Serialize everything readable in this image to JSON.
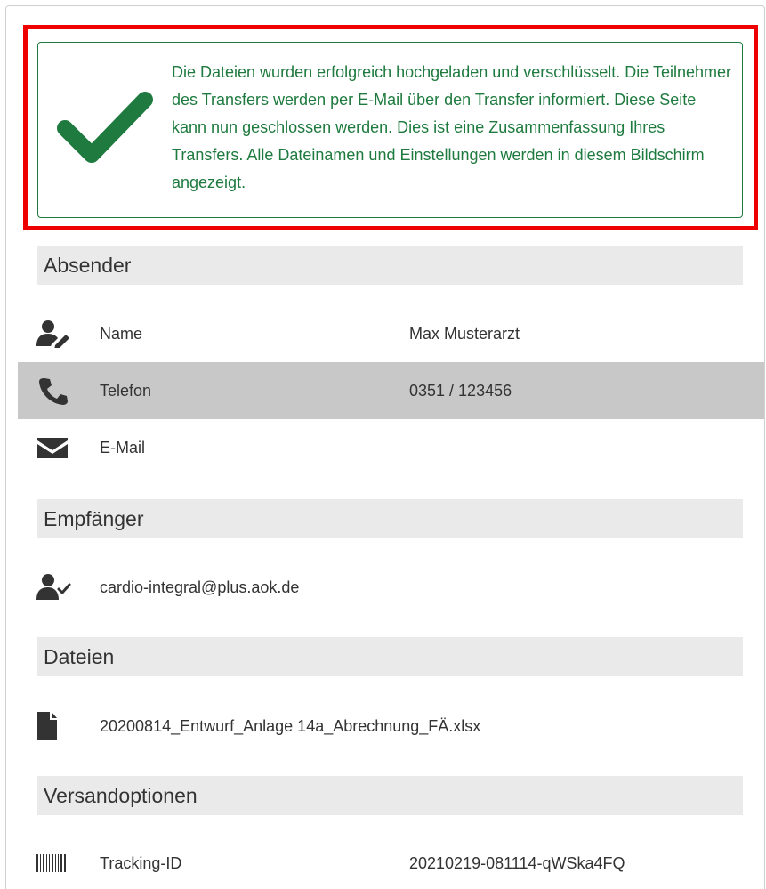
{
  "success": {
    "message": "Die Dateien wurden erfolgreich hochgeladen und verschlüsselt. Die Teilnehmer des Transfers werden per E-Mail über den Transfer informiert. Diese Seite kann nun geschlossen werden. Dies ist eine Zusammenfassung Ihres Transfers. Alle Dateinamen und Einstellungen werden in diesem Bildschirm angezeigt.",
    "check_icon": "checkmark-icon",
    "color": "#1e7a3e"
  },
  "highlight_color": "#ee0000",
  "sender": {
    "title": "Absender",
    "rows": [
      {
        "icon": "user-edit-icon",
        "label": "Name",
        "value": "Max Musterarzt"
      },
      {
        "icon": "phone-icon",
        "label": "Telefon",
        "value": "0351 / 123456"
      },
      {
        "icon": "envelope-icon",
        "label": "E-Mail",
        "value": ""
      }
    ]
  },
  "recipient": {
    "title": "Empfänger",
    "rows": [
      {
        "icon": "user-check-icon",
        "label": "cardio-integral@plus.aok.de"
      }
    ]
  },
  "files": {
    "title": "Dateien",
    "rows": [
      {
        "icon": "file-icon",
        "label": "20200814_Entwurf_Anlage 14a_Abrechnung_FÄ.xlsx"
      }
    ]
  },
  "options": {
    "title": "Versandoptionen",
    "rows": [
      {
        "icon": "barcode-icon",
        "label": "Tracking-ID",
        "value": "20210219-081114-qWSka4FQ"
      }
    ]
  }
}
